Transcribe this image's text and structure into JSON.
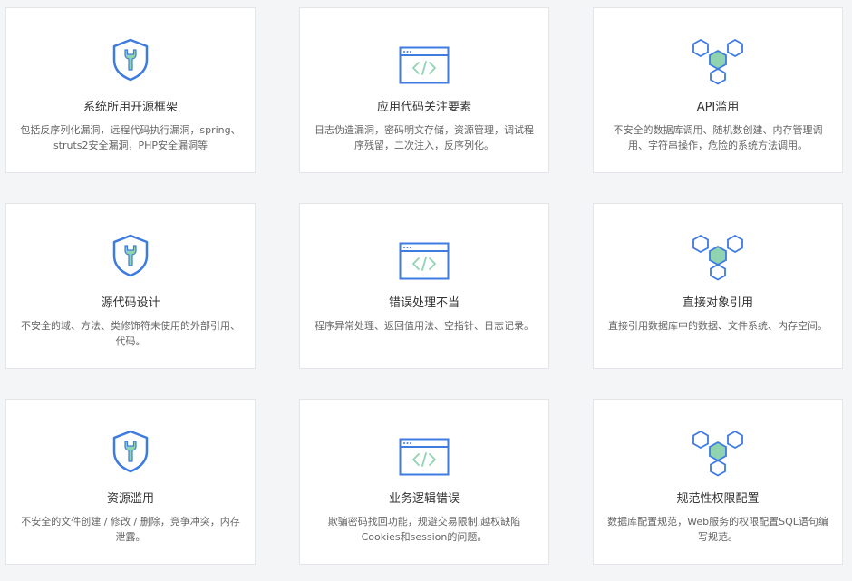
{
  "colors": {
    "blue": "#3d7be0",
    "green": "#8fd3b0",
    "card_bg": "#ffffff",
    "page_bg": "#f4f5f7"
  },
  "cards": [
    {
      "icon": "shield-wrench-icon",
      "title": "系统所用开源框架",
      "desc": "包括反序列化漏洞，远程代码执行漏洞，spring、struts2安全漏洞，PHP安全漏洞等"
    },
    {
      "icon": "code-window-icon",
      "title": "应用代码关注要素",
      "desc": "日志伪造漏洞，密码明文存储，资源管理，调试程序残留，二次注入，反序列化。"
    },
    {
      "icon": "hexagon-cluster-icon",
      "title": "API滥用",
      "desc": "不安全的数据库调用、随机数创建、内存管理调用、字符串操作，危险的系统方法调用。"
    },
    {
      "icon": "shield-wrench-icon",
      "title": "源代码设计",
      "desc": "不安全的域、方法、类修饰符未使用的外部引用、代码。"
    },
    {
      "icon": "code-window-icon",
      "title": "错误处理不当",
      "desc": "程序异常处理、返回值用法、空指针、日志记录。"
    },
    {
      "icon": "hexagon-cluster-icon",
      "title": "直接对象引用",
      "desc": "直接引用数据库中的数据、文件系统、内存空间。"
    },
    {
      "icon": "shield-wrench-icon",
      "title": "资源滥用",
      "desc": "不安全的文件创建 / 修改 / 删除，竞争冲突，内存泄露。"
    },
    {
      "icon": "code-window-icon",
      "title": "业务逻辑错误",
      "desc": "欺骗密码找回功能，规避交易限制,越权缺陷Cookies和session的问题。"
    },
    {
      "icon": "hexagon-cluster-icon",
      "title": "规范性权限配置",
      "desc": "数据库配置规范，Web服务的权限配置SQL语句编写规范。"
    }
  ]
}
